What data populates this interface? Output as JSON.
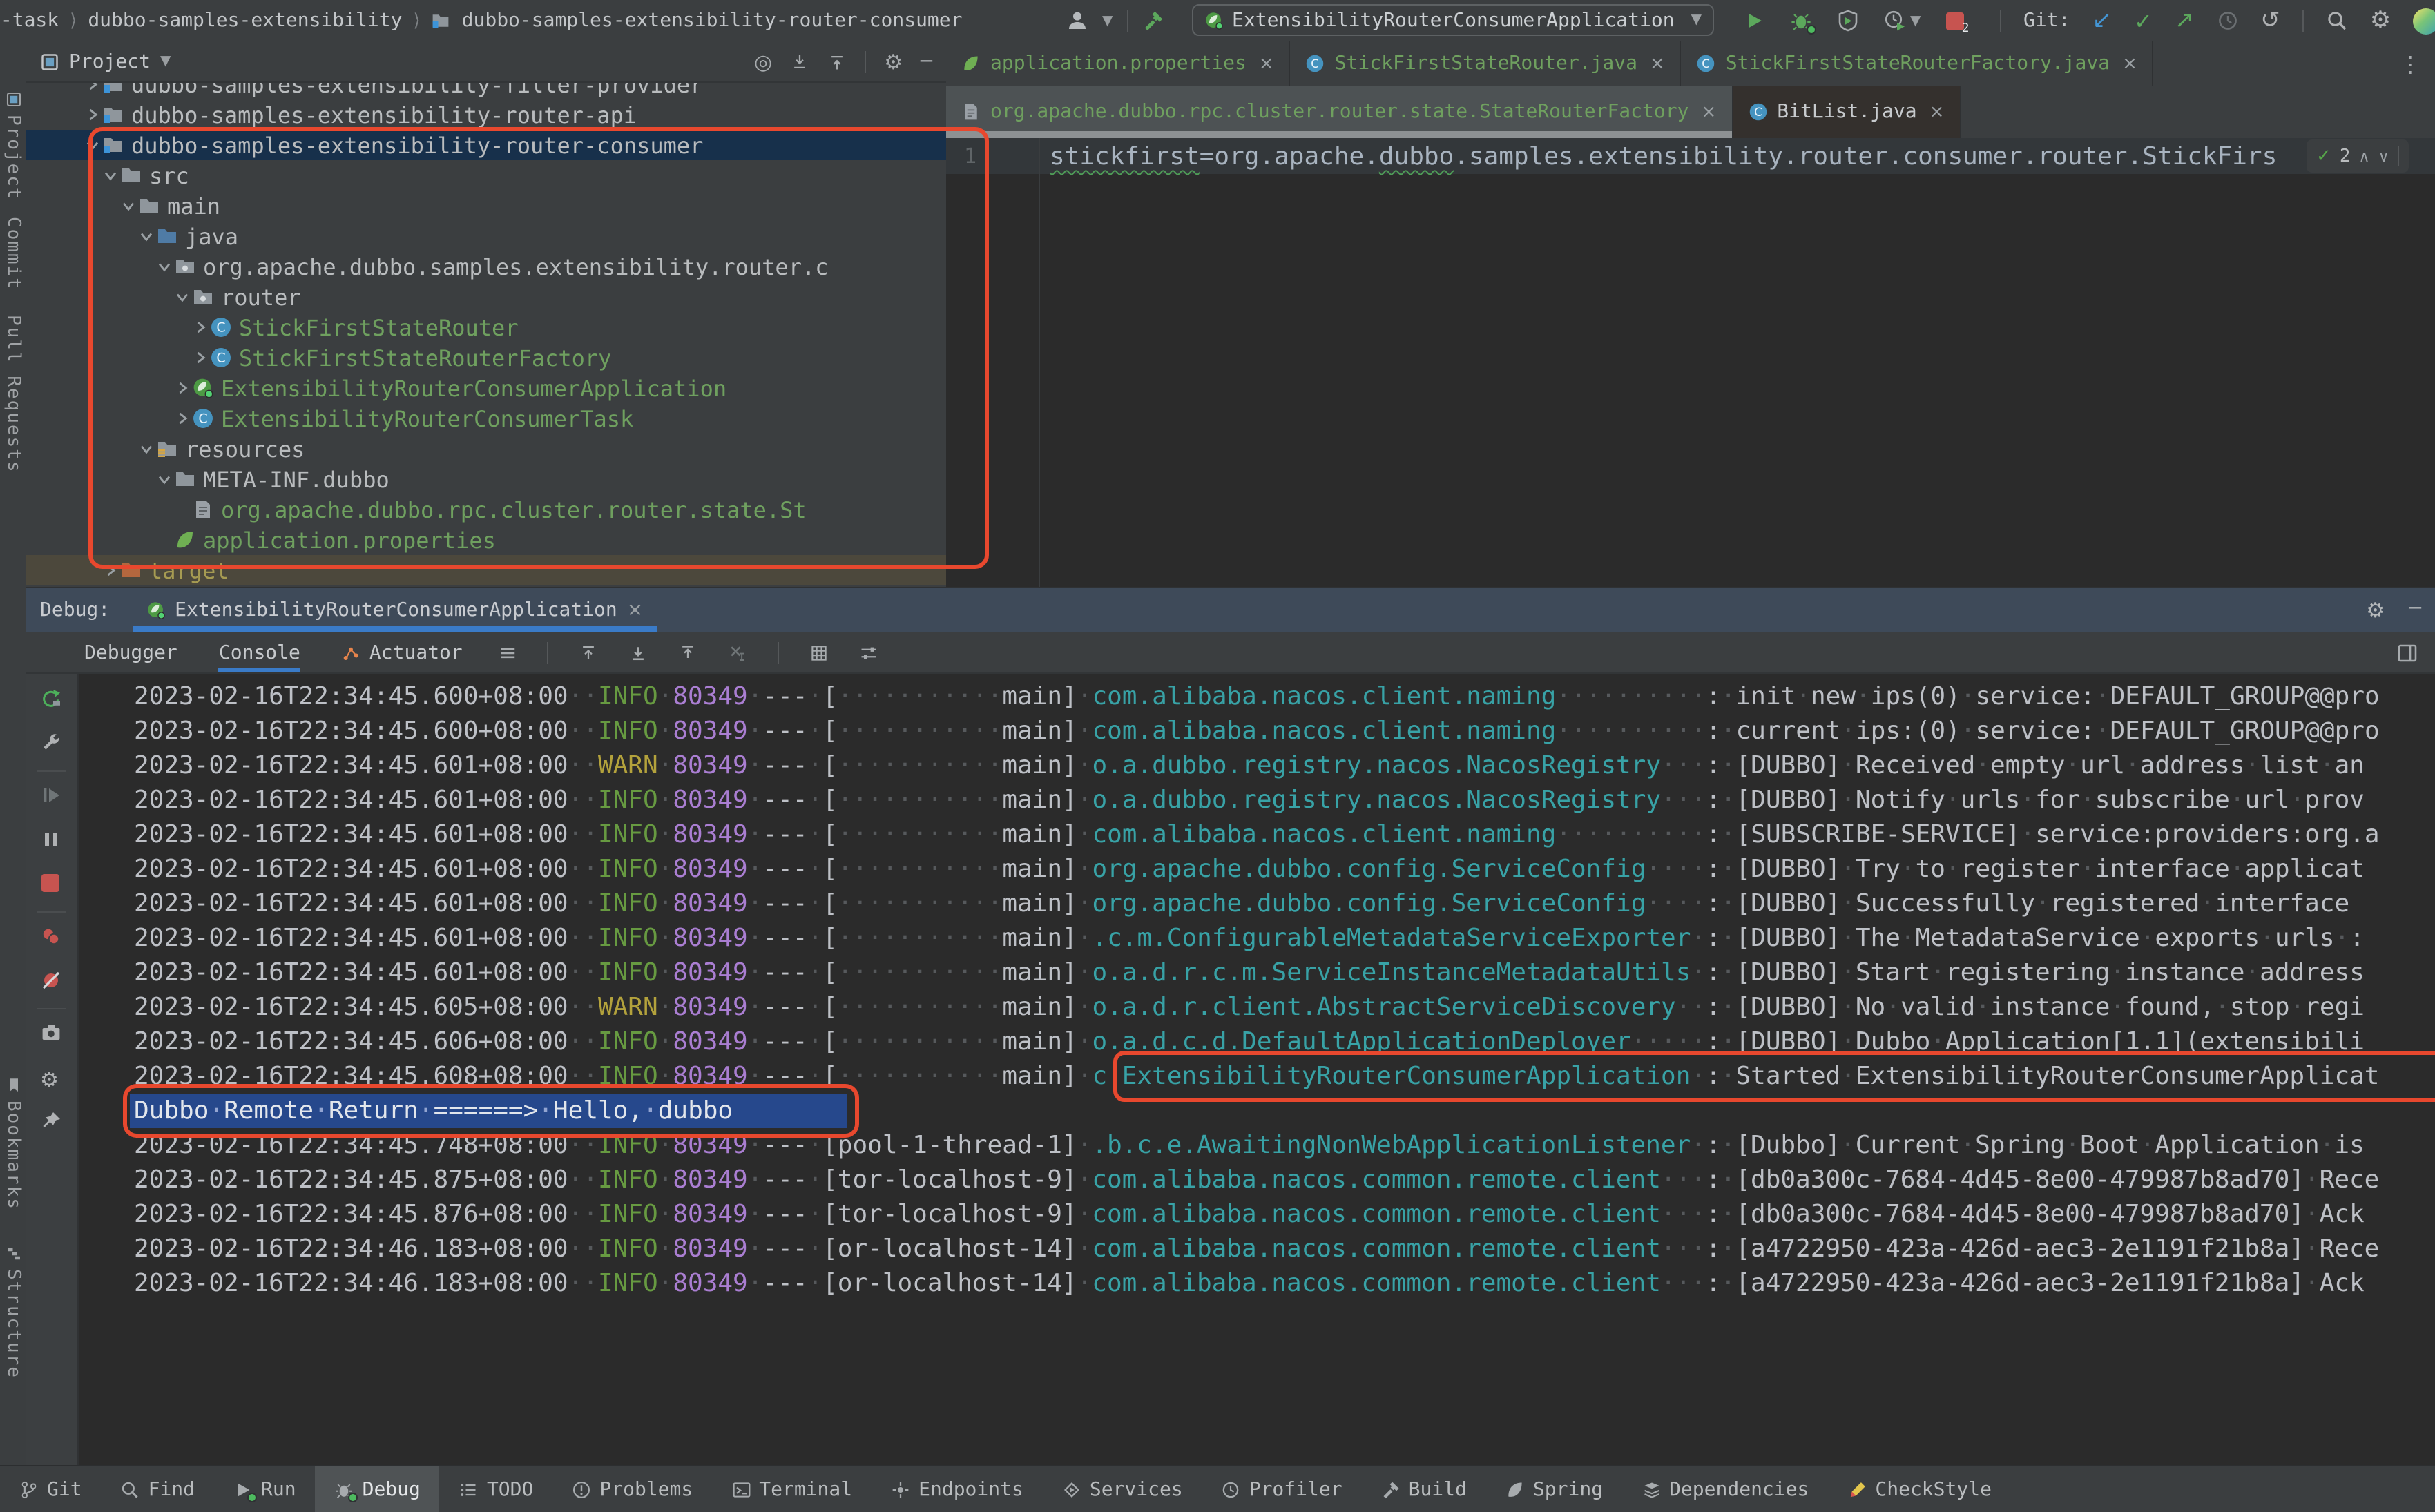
{
  "titlebar": {
    "breadcrumbs": [
      "o-task",
      "dubbo-samples-extensibility",
      "dubbo-samples-extensibility-router-consumer"
    ],
    "run_config": "ExtensibilityRouterConsumerApplication",
    "git_label": "Git:",
    "stop_count": "2"
  },
  "left_strip": {
    "top": [
      "Project",
      "Commit",
      "Pull Requests"
    ],
    "bottom": [
      "Bookmarks",
      "Structure"
    ]
  },
  "project": {
    "title": "Project",
    "tree": [
      {
        "label": "dubbo-samples-extensibility-filter-provider",
        "level": 1,
        "chev": "closed",
        "icon": "module"
      },
      {
        "label": "dubbo-samples-extensibility-router-api",
        "level": 1,
        "chev": "closed",
        "icon": "module"
      },
      {
        "label": "dubbo-samples-extensibility-router-consumer",
        "level": 1,
        "chev": "open",
        "icon": "module",
        "selected": true
      },
      {
        "label": "src",
        "level": 2,
        "chev": "open",
        "icon": "folder"
      },
      {
        "label": "main",
        "level": 3,
        "chev": "open",
        "icon": "folder"
      },
      {
        "label": "java",
        "level": 4,
        "chev": "open",
        "icon": "folder-java"
      },
      {
        "label": "org.apache.dubbo.samples.extensibility.router.c",
        "level": 5,
        "chev": "open",
        "icon": "package"
      },
      {
        "label": "router",
        "level": 6,
        "chev": "open",
        "icon": "package"
      },
      {
        "label": "StickFirstStateRouter",
        "level": 7,
        "chev": "closed",
        "icon": "class",
        "green": true
      },
      {
        "label": "StickFirstStateRouterFactory",
        "level": 7,
        "chev": "closed",
        "icon": "class",
        "green": true
      },
      {
        "label": "ExtensibilityRouterConsumerApplication",
        "level": 6,
        "chev": "closed",
        "icon": "springboot",
        "green": true
      },
      {
        "label": "ExtensibilityRouterConsumerTask",
        "level": 6,
        "chev": "closed",
        "icon": "class",
        "green": true
      },
      {
        "label": "resources",
        "level": 4,
        "chev": "open",
        "icon": "folder-resources"
      },
      {
        "label": "META-INF.dubbo",
        "level": 5,
        "chev": "open",
        "icon": "folder"
      },
      {
        "label": "org.apache.dubbo.rpc.cluster.router.state.St",
        "level": 6,
        "chev": "none",
        "icon": "file",
        "green": true
      },
      {
        "label": "application.properties",
        "level": 5,
        "chev": "none",
        "icon": "spring-leaf",
        "green": true
      },
      {
        "label": "target",
        "level": 2,
        "chev": "closed",
        "icon": "folder-excluded",
        "excluded": true
      }
    ]
  },
  "editor": {
    "tabs_row1": [
      {
        "label": "application.properties",
        "icon": "spring-leaf",
        "green": true
      },
      {
        "label": "StickFirstStateRouter.java",
        "icon": "class",
        "green": true
      },
      {
        "label": "StickFirstStateRouterFactory.java",
        "icon": "class",
        "green": true
      }
    ],
    "tabs_row2": [
      {
        "label": "org.apache.dubbo.rpc.cluster.router.state.StateRouterFactory",
        "icon": "file",
        "green": true,
        "active": true
      },
      {
        "label": "BitList.java",
        "icon": "class",
        "dim": true
      }
    ],
    "gutter_line": "1",
    "code": {
      "typo1": "stickfirst",
      "mid": "=org.apache.",
      "typo2": "dubbo",
      "tail": ".samples.extensibility.router.consumer.router.StickFirs"
    },
    "inspections": {
      "check_count": "2"
    }
  },
  "debug": {
    "label": "Debug:",
    "session": "ExtensibilityRouterConsumerApplication",
    "tabs": [
      {
        "label": "Debugger"
      },
      {
        "label": "Console",
        "active": true
      },
      {
        "label": "Actuator",
        "icon": "actuator"
      }
    ],
    "console": [
      {
        "time": "2023-02-16T22:34:45.600+08:00",
        "level": "INFO",
        "pid": "80349",
        "thread": "main",
        "logger": "com.alibaba.nacos.client.naming",
        "msg": "init new ips(0) service: DEFAULT_GROUP@@pro"
      },
      {
        "time": "2023-02-16T22:34:45.600+08:00",
        "level": "INFO",
        "pid": "80349",
        "thread": "main",
        "logger": "com.alibaba.nacos.client.naming",
        "msg": "current ips:(0) service: DEFAULT_GROUP@@pro"
      },
      {
        "time": "2023-02-16T22:34:45.601+08:00",
        "level": "WARN",
        "pid": "80349",
        "thread": "main",
        "logger": "o.a.dubbo.registry.nacos.NacosRegistry",
        "msg": "[DUBBO] Received empty url address list an"
      },
      {
        "time": "2023-02-16T22:34:45.601+08:00",
        "level": "INFO",
        "pid": "80349",
        "thread": "main",
        "logger": "o.a.dubbo.registry.nacos.NacosRegistry",
        "msg": "[DUBBO] Notify urls for subscribe url prov"
      },
      {
        "time": "2023-02-16T22:34:45.601+08:00",
        "level": "INFO",
        "pid": "80349",
        "thread": "main",
        "logger": "com.alibaba.nacos.client.naming",
        "msg": "[SUBSCRIBE-SERVICE] service:providers:org.a"
      },
      {
        "time": "2023-02-16T22:34:45.601+08:00",
        "level": "INFO",
        "pid": "80349",
        "thread": "main",
        "logger": "org.apache.dubbo.config.ServiceConfig",
        "msg": "[DUBBO] Try to register interface applicat"
      },
      {
        "time": "2023-02-16T22:34:45.601+08:00",
        "level": "INFO",
        "pid": "80349",
        "thread": "main",
        "logger": "org.apache.dubbo.config.ServiceConfig",
        "msg": "[DUBBO] Successfully registered interface"
      },
      {
        "time": "2023-02-16T22:34:45.601+08:00",
        "level": "INFO",
        "pid": "80349",
        "thread": "main",
        "logger": ".c.m.ConfigurableMetadataServiceExporter",
        "msg": "[DUBBO] The MetadataService exports urls :"
      },
      {
        "time": "2023-02-16T22:34:45.601+08:00",
        "level": "INFO",
        "pid": "80349",
        "thread": "main",
        "logger": "o.a.d.r.c.m.ServiceInstanceMetadataUtils",
        "msg": "[DUBBO] Start registering instance address"
      },
      {
        "time": "2023-02-16T22:34:45.605+08:00",
        "level": "WARN",
        "pid": "80349",
        "thread": "main",
        "logger": "o.a.d.r.client.AbstractServiceDiscovery",
        "msg": "[DUBBO] No valid instance found, stop regi"
      },
      {
        "time": "2023-02-16T22:34:45.606+08:00",
        "level": "INFO",
        "pid": "80349",
        "thread": "main",
        "logger": "o.a.d.c.d.DefaultApplicationDeployer",
        "msg": "[DUBBO] Dubbo Application[1.1](extensibili"
      },
      {
        "time": "2023-02-16T22:34:45.608+08:00",
        "level": "INFO",
        "pid": "80349",
        "thread": "main",
        "logger": "c.ExtensibilityRouterConsumerApplication",
        "msg": "Started ExtensibilityRouterConsumerApplicat"
      },
      {
        "text": "Dubbo Remote Return ======> Hello, dubbo"
      },
      {
        "time": "2023-02-16T22:34:45.748+08:00",
        "level": "INFO",
        "pid": "80349",
        "thread": "pool-1-thread-1",
        "logger": ".b.c.e.AwaitingNonWebApplicationListener",
        "msg": "[Dubbo] Current Spring Boot Application is"
      },
      {
        "time": "2023-02-16T22:34:45.875+08:00",
        "level": "INFO",
        "pid": "80349",
        "thread": "tor-localhost-9",
        "logger": "com.alibaba.nacos.common.remote.client",
        "msg": "[db0a300c-7684-4d45-8e00-479987b8ad70] Rece"
      },
      {
        "time": "2023-02-16T22:34:45.876+08:00",
        "level": "INFO",
        "pid": "80349",
        "thread": "tor-localhost-9",
        "logger": "com.alibaba.nacos.common.remote.client",
        "msg": "[db0a300c-7684-4d45-8e00-479987b8ad70] Ack"
      },
      {
        "time": "2023-02-16T22:34:46.183+08:00",
        "level": "INFO",
        "pid": "80349",
        "thread": "or-localhost-14",
        "logger": "com.alibaba.nacos.common.remote.client",
        "msg": "[a4722950-423a-426d-aec3-2e1191f21b8a] Rece"
      },
      {
        "time": "2023-02-16T22:34:46.183+08:00",
        "level": "INFO",
        "pid": "80349",
        "thread": "or-localhost-14",
        "logger": "com.alibaba.nacos.common.remote.client",
        "msg": "[a4722950-423a-426d-aec3-2e1191f21b8a] Ack"
      }
    ]
  },
  "bottom_bar": {
    "items": [
      {
        "label": "Git",
        "icon": "git-branch"
      },
      {
        "label": "Find",
        "icon": "search"
      },
      {
        "label": "Run",
        "icon": "play",
        "dot": true
      },
      {
        "label": "Debug",
        "icon": "bug",
        "dot": true,
        "active": true
      },
      {
        "label": "TODO",
        "icon": "todo"
      },
      {
        "label": "Problems",
        "icon": "problems"
      },
      {
        "label": "Terminal",
        "icon": "terminal"
      },
      {
        "label": "Endpoints",
        "icon": "endpoints"
      },
      {
        "label": "Services",
        "icon": "services"
      },
      {
        "label": "Profiler",
        "icon": "clock"
      },
      {
        "label": "Build",
        "icon": "hammer"
      },
      {
        "label": "Spring",
        "icon": "spring-leaf-gray"
      },
      {
        "label": "Dependencies",
        "icon": "dependencies"
      },
      {
        "label": "CheckStyle",
        "icon": "checkstyle"
      }
    ]
  },
  "colors": {
    "annotation_red": "#e8482e",
    "accent_blue": "#3a7bc8",
    "added_file_green": "#6fa05f",
    "console_highlight_blue": "#26488c",
    "info_green": "#679a41",
    "warn_yellow": "#b3a23c",
    "pid_purple": "#aa7ed2",
    "logger_teal": "#38a2a6"
  }
}
